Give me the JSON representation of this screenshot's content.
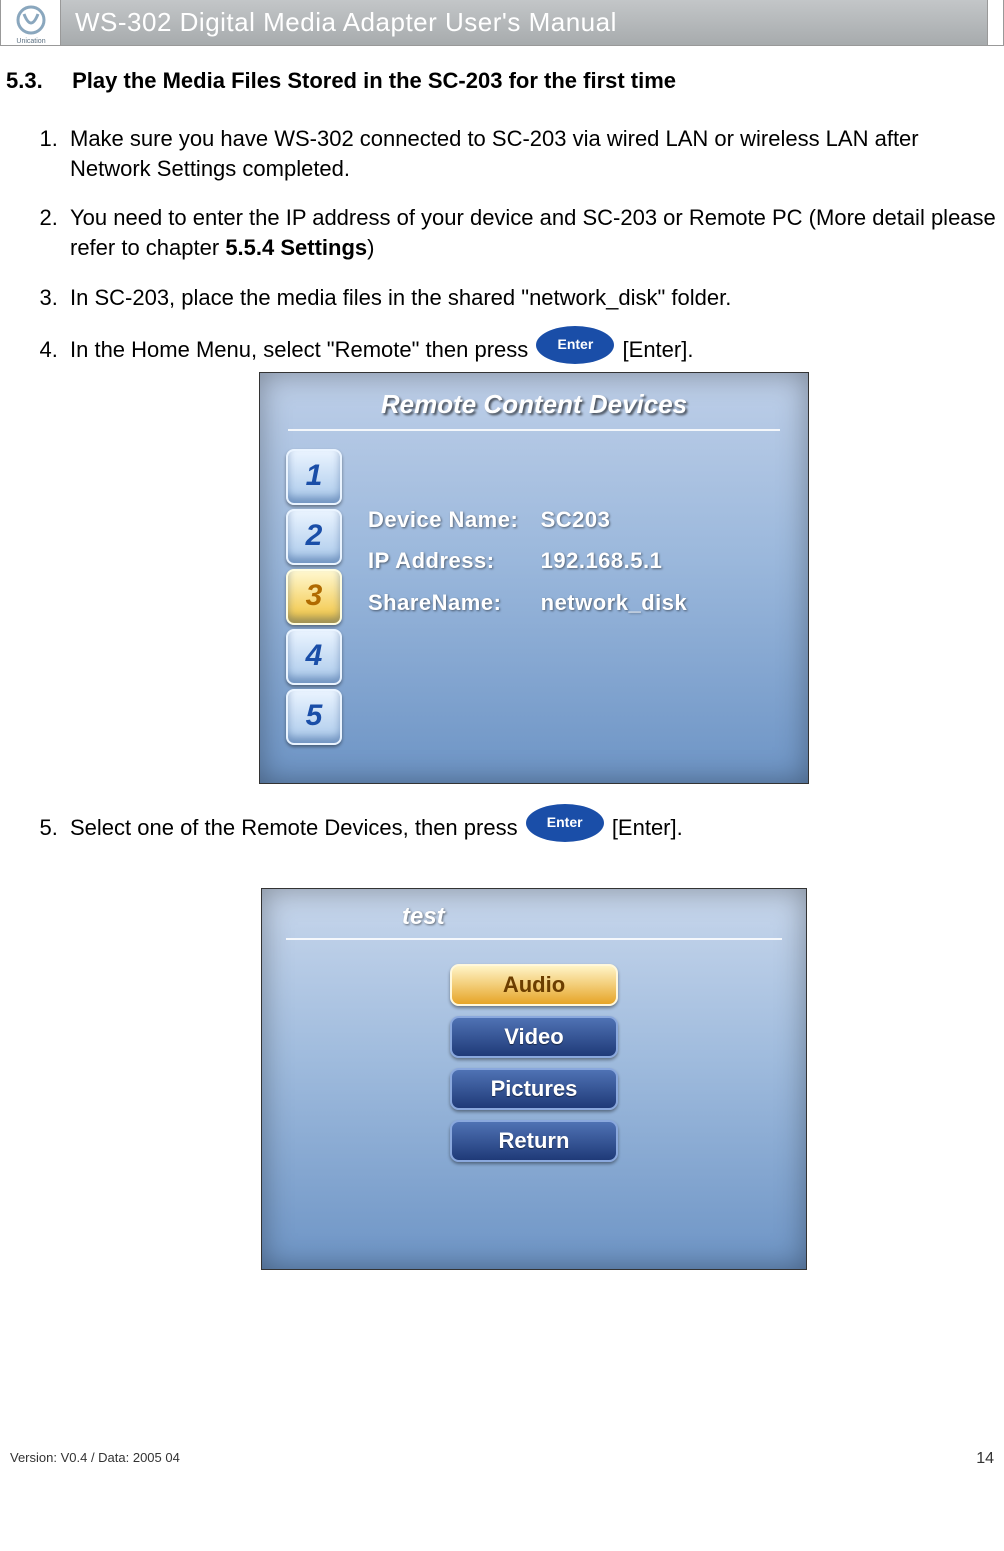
{
  "header": {
    "title": "WS-302 Digital Media Adapter User's Manual",
    "logo_label": "Unication"
  },
  "section": {
    "number": "5.3.",
    "title": "Play the Media Files Stored in the SC-203 for the first time"
  },
  "steps": {
    "s1": "Make sure you have WS-302 connected to SC-203 via wired LAN or wireless LAN after Network Settings completed.",
    "s2a": "You need to enter the IP address of your device and SC-203 or Remote PC (More detail please refer to chapter ",
    "s2b_bold": "5.5.4 Settings",
    "s2c": ")",
    "s3": "In SC-203, place the media files in the shared \"network_disk\" folder.",
    "s4a": "In the Home Menu, select \"Remote\" then press ",
    "s4b": "[Enter].",
    "s5a": "Select one of the Remote Devices, then press ",
    "s5b": "[Enter]."
  },
  "enter_label": "Enter",
  "screenshot1": {
    "title": "Remote Content Devices",
    "numbers": [
      "1",
      "2",
      "3",
      "4",
      "5"
    ],
    "selected_index": 2,
    "rows": {
      "r1_label": "Device Name:",
      "r1_value": "SC203",
      "r2_label": "IP Address:",
      "r2_value": "192.168.5.1",
      "r3_label": "ShareName:",
      "r3_value": "network_disk"
    }
  },
  "screenshot2": {
    "breadcrumb": "test",
    "menu": [
      "Audio",
      "Video",
      "Pictures",
      "Return"
    ],
    "selected_index": 0
  },
  "footer": {
    "version": "Version: V0.4 / Data: 2005 04",
    "page": "14"
  }
}
